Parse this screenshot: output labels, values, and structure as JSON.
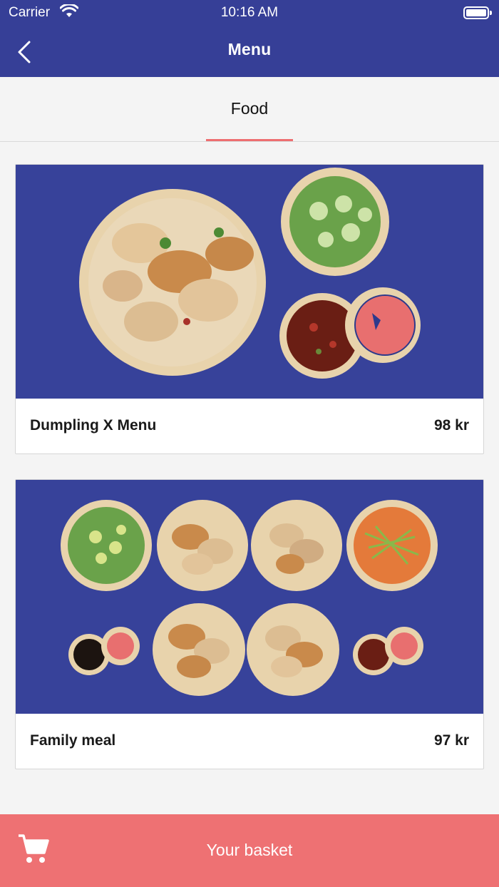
{
  "status_bar": {
    "carrier": "Carrier",
    "time": "10:16 AM"
  },
  "header": {
    "title": "Menu",
    "back_icon": "chevron-left-icon"
  },
  "tabs": [
    {
      "label": "Food",
      "selected": true
    }
  ],
  "menu_items": [
    {
      "name": "Dumpling X Menu",
      "price": "98 kr"
    },
    {
      "name": "Family meal",
      "price": "97 kr"
    }
  ],
  "basket": {
    "label": "Your basket",
    "icon": "cart-icon"
  },
  "colors": {
    "header": "#363f97",
    "accent": "#ee6e70",
    "basket": "#ee7173",
    "image_bg": "#37429a"
  }
}
